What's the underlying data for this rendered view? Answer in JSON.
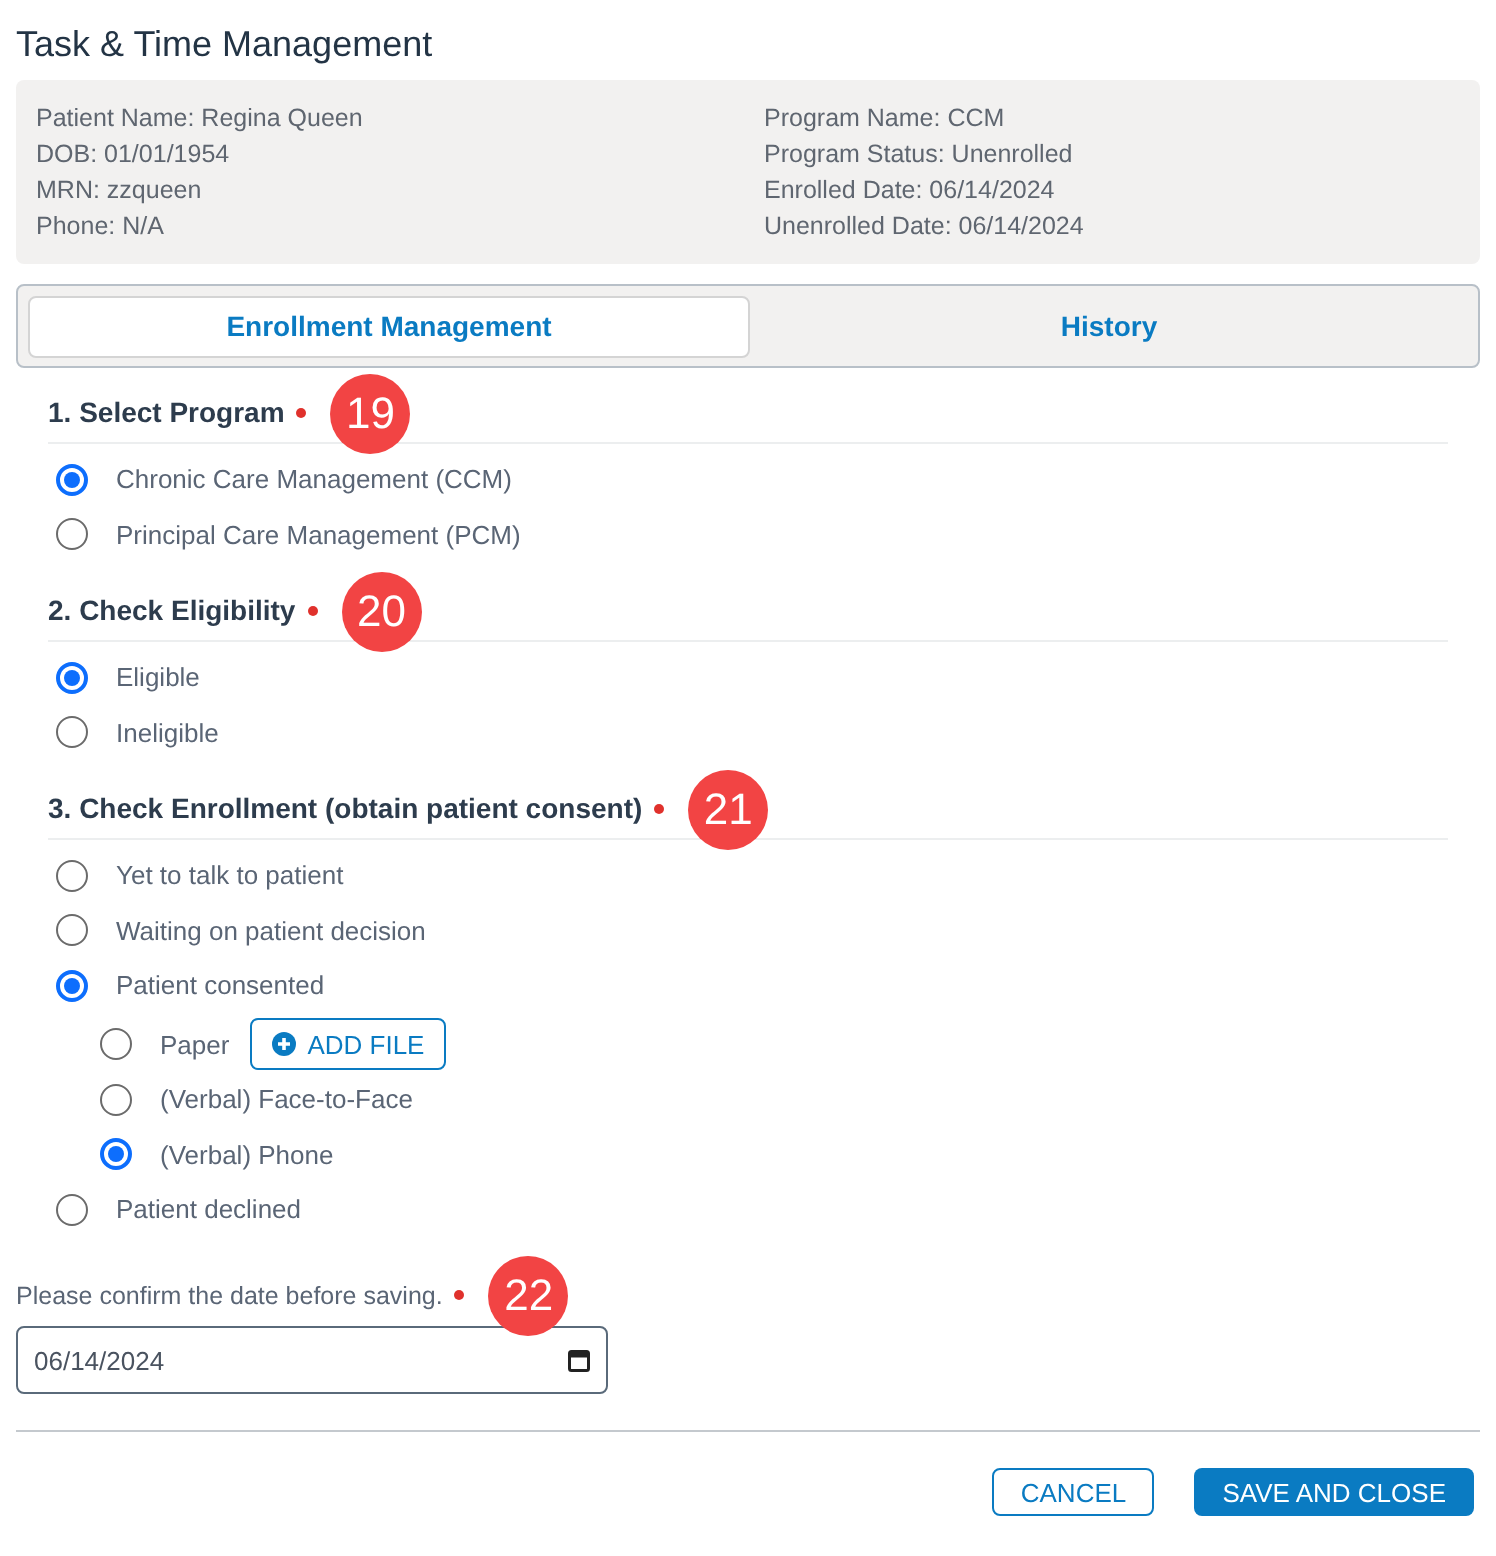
{
  "title": "Task & Time Management",
  "patient_info": {
    "left": [
      "Patient Name: Regina Queen",
      "DOB: 01/01/1954",
      "MRN: zzqueen",
      "Phone: N/A"
    ],
    "right": [
      "Program Name: CCM",
      "Program Status: Unenrolled",
      "Enrolled Date: 06/14/2024",
      "Unenrolled Date: 06/14/2024"
    ]
  },
  "tabs": [
    {
      "label": "Enrollment Management",
      "selected": true
    },
    {
      "label": "History",
      "selected": false
    }
  ],
  "sections": [
    {
      "title": "1. Select Program",
      "required": true,
      "marker": "19",
      "options": [
        {
          "label": "Chronic Care Management (CCM)",
          "selected": true
        },
        {
          "label": "Principal Care Management (PCM)",
          "selected": false
        }
      ]
    },
    {
      "title": "2. Check Eligibility",
      "required": true,
      "marker": "20",
      "options": [
        {
          "label": "Eligible",
          "selected": true
        },
        {
          "label": "Ineligible",
          "selected": false
        }
      ]
    },
    {
      "title": "3. Check Enrollment (obtain patient consent)",
      "required": true,
      "marker": "21",
      "options": [
        {
          "label": "Yet to talk to patient",
          "selected": false
        },
        {
          "label": "Waiting on patient decision",
          "selected": false
        },
        {
          "label": "Patient consented",
          "selected": true,
          "sub_options": [
            {
              "label": "Paper",
              "selected": false,
              "button": "ADD FILE"
            },
            {
              "label": "(Verbal) Face-to-Face",
              "selected": false
            },
            {
              "label": "(Verbal) Phone",
              "selected": true
            }
          ]
        },
        {
          "label": "Patient declined",
          "selected": false
        }
      ]
    }
  ],
  "date": {
    "label": "Please confirm the date before saving.",
    "required": true,
    "marker": "22",
    "value": "06/14/2024"
  },
  "buttons": [
    {
      "label": "CANCEL",
      "kind": "outline"
    },
    {
      "label": "SAVE AND CLOSE",
      "kind": "primary"
    }
  ]
}
